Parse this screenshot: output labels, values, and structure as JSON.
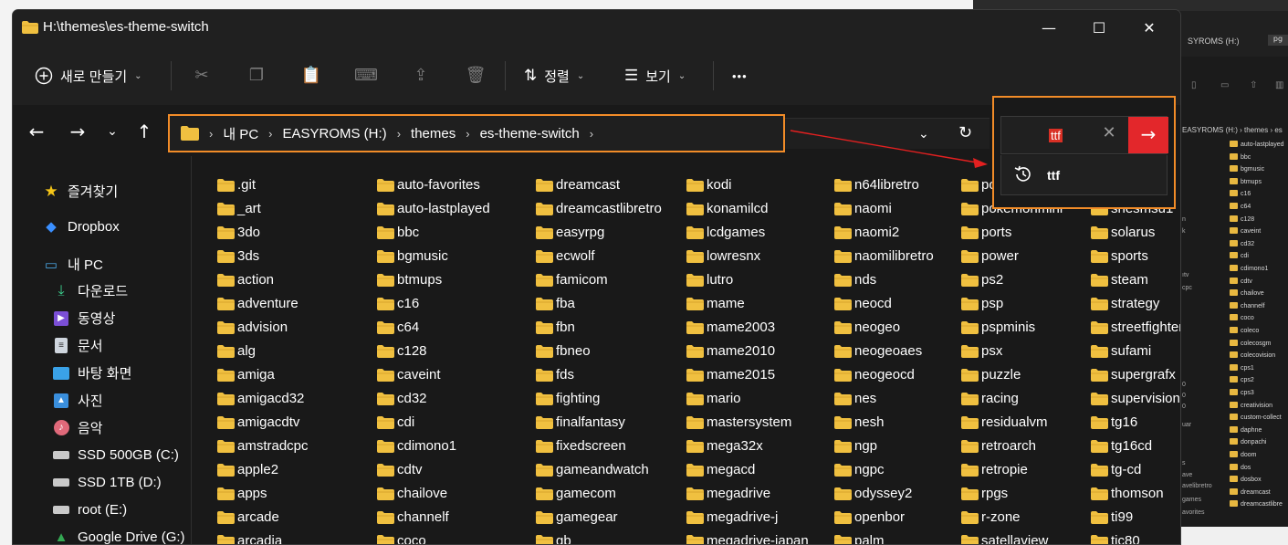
{
  "window": {
    "title": "H:\\themes\\es-theme-switch",
    "controls": [
      "—",
      "☐",
      "✕"
    ]
  },
  "toolbar": {
    "new_label": "새로 만들기",
    "sort_label": "정렬",
    "view_label": "보기",
    "more_label": "•••"
  },
  "address": {
    "crumbs": [
      "내 PC",
      "EASYROMS (H:)",
      "themes",
      "es-theme-switch"
    ]
  },
  "search": {
    "value": "ttf",
    "suggestion": "ttf"
  },
  "sidebar": {
    "items": [
      {
        "label": "즐겨찾기",
        "icon": "star-icon"
      },
      {
        "label": "Dropbox",
        "icon": "dropbox-icon"
      },
      {
        "label": "내 PC",
        "icon": "pc-icon"
      },
      {
        "label": "다운로드",
        "icon": "download-icon"
      },
      {
        "label": "동영상",
        "icon": "video-icon"
      },
      {
        "label": "문서",
        "icon": "document-icon"
      },
      {
        "label": "바탕 화면",
        "icon": "desktop-icon"
      },
      {
        "label": "사진",
        "icon": "pictures-icon"
      },
      {
        "label": "음악",
        "icon": "music-icon"
      },
      {
        "label": "SSD 500GB (C:)",
        "icon": "drive-icon"
      },
      {
        "label": "SSD 1TB (D:)",
        "icon": "drive-icon"
      },
      {
        "label": "root (E:)",
        "icon": "drive-icon"
      },
      {
        "label": "Google Drive (G:)",
        "icon": "google-drive-icon"
      }
    ]
  },
  "files": {
    "columns": [
      [
        ".git",
        "_art",
        "3do",
        "3ds",
        "action",
        "adventure",
        "advision",
        "alg",
        "amiga",
        "amigacd32",
        "amigacdtv",
        "amstradcpc",
        "apple2",
        "apps",
        "arcade",
        "arcadia"
      ],
      [
        "auto-favorites",
        "auto-lastplayed",
        "bbc",
        "bgmusic",
        "btmups",
        "c16",
        "c64",
        "c128",
        "caveint",
        "cd32",
        "cdi",
        "cdimono1",
        "cdtv",
        "chailove",
        "channelf",
        "coco"
      ],
      [
        "dreamcast",
        "dreamcastlibretro",
        "easyrpg",
        "ecwolf",
        "famicom",
        "fba",
        "fbn",
        "fbneo",
        "fds",
        "fighting",
        "finalfantasy",
        "fixedscreen",
        "gameandwatch",
        "gamecom",
        "gamegear",
        "gb"
      ],
      [
        "kodi",
        "konamilcd",
        "lcdgames",
        "lowresnx",
        "lutro",
        "mame",
        "mame2003",
        "mame2010",
        "mame2015",
        "mario",
        "mastersystem",
        "mega32x",
        "megacd",
        "megadrive",
        "megadrive-j",
        "megadrive-japan"
      ],
      [
        "n64libretro",
        "naomi",
        "naomi2",
        "naomilibretro",
        "nds",
        "neocd",
        "neogeo",
        "neogeoaes",
        "neogeocd",
        "nes",
        "nesh",
        "ngp",
        "ngpc",
        "odyssey2",
        "openbor",
        "palm"
      ],
      [
        "pol",
        "pokemonmini",
        "ports",
        "power",
        "ps2",
        "psp",
        "pspminis",
        "psx",
        "puzzle",
        "racing",
        "residualvm",
        "retroarch",
        "retropie",
        "rpgs",
        "r-zone",
        "satellaview"
      ],
      [
        "s",
        "snesmsu1",
        "solarus",
        "sports",
        "steam",
        "strategy",
        "streetfighter",
        "sufami",
        "supergrafx",
        "supervision",
        "tg16",
        "tg16cd",
        "tg-cd",
        "thomson",
        "ti99",
        "tic80"
      ]
    ]
  },
  "background_window": {
    "title": "SYROMS (H:)",
    "tab": "pg",
    "crumb": "EASYROMS (H:)  ›  themes  ›  es",
    "side": [
      "n",
      "k",
      "ıtv",
      "cpc",
      "0",
      "0",
      "0",
      "uar",
      "s",
      "ave",
      "avelibretro",
      "games",
      "avorites"
    ],
    "files": [
      "auto-lastplayed",
      "bbc",
      "bgmusic",
      "btmups",
      "c16",
      "c64",
      "c128",
      "caveint",
      "cd32",
      "cdi",
      "cdimono1",
      "cdtv",
      "chailove",
      "channelf",
      "coco",
      "coleco",
      "colecosgm",
      "colecovision",
      "cps1",
      "cps2",
      "cps3",
      "creativision",
      "custom-collect",
      "daphne",
      "donpachi",
      "doom",
      "dos",
      "dosbox",
      "dreamcast",
      "dreamcastlibre"
    ]
  },
  "colors": {
    "highlight": "#f28c28",
    "search_go": "#e3272b",
    "folder": "#f0c040",
    "window_bg": "#191919"
  }
}
